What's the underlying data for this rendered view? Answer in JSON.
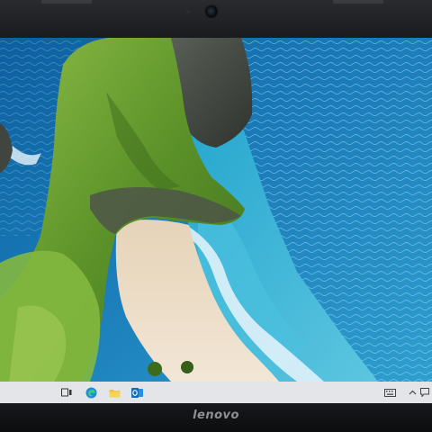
{
  "device": {
    "brand_logo": "lenovo"
  },
  "desktop": {
    "wallpaper": "coastal-cliff-beach-photo",
    "colors": {
      "sea": "#1a7bb8",
      "sea_light": "#3fb8da",
      "cliff_green": "#6aa136",
      "sand": "#ecdcc6"
    }
  },
  "taskbar": {
    "background": "#e3e5e8",
    "pinned": [
      {
        "name": "task-view",
        "icon": "task-view-icon"
      },
      {
        "name": "edge",
        "icon": "edge-icon"
      },
      {
        "name": "file-explorer",
        "icon": "folder-icon"
      },
      {
        "name": "outlook",
        "icon": "outlook-icon"
      }
    ],
    "tray": [
      {
        "name": "keyboard",
        "icon": "keyboard-icon"
      },
      {
        "name": "show-hidden",
        "icon": "chevron-up-icon"
      },
      {
        "name": "action-center",
        "icon": "notification-icon"
      }
    ]
  }
}
